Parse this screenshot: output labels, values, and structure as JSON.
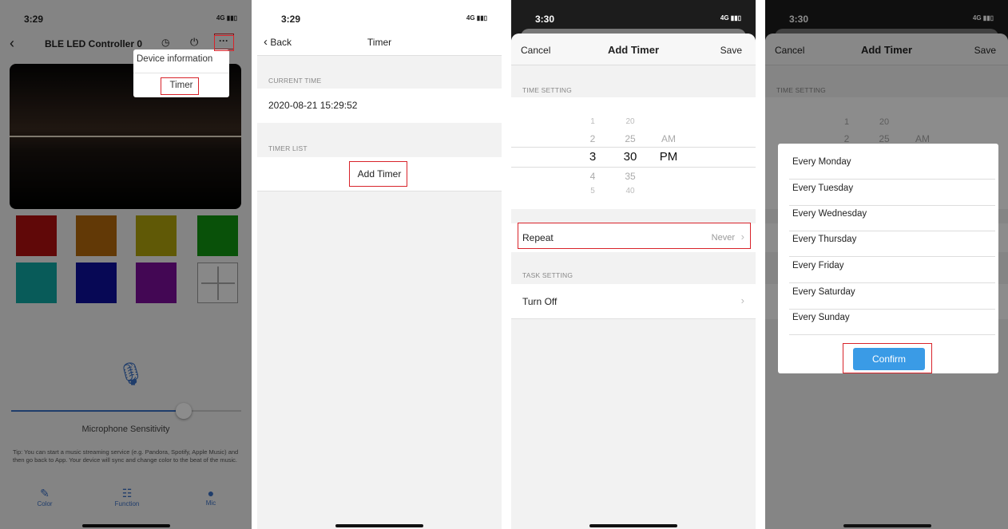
{
  "status_times": [
    "3:29",
    "3:29",
    "3:30",
    "3:30"
  ],
  "signal": "4G",
  "p1": {
    "device_title": "BLE LED Controller 0",
    "menu": {
      "device_information": "Device information",
      "timer": "Timer"
    },
    "mic_sensitivity_label": "Microphone Sensitivity",
    "tip": "Tip: You can start a music streaming service (e.g. Pandora, Spotify, Apple Music) and then go back to App. Your device will sync and change color to the beat of the music.",
    "tabs": {
      "color": "Color",
      "function": "Function",
      "mic": "Mic"
    },
    "swatches": [
      "#b01010",
      "#b2690c",
      "#b0a20c",
      "#119411",
      "#10a6a2",
      "#0e0f9c",
      "#7a0e99"
    ]
  },
  "p2": {
    "back": "Back",
    "title": "Timer",
    "current_time_header": "CURRENT TIME",
    "current_time": "2020-08-21 15:29:52",
    "timer_list_header": "TIMER LIST",
    "add_timer": "Add Timer"
  },
  "p3": {
    "cancel": "Cancel",
    "title": "Add Timer",
    "save": "Save",
    "time_setting_header": "TIME SETTING",
    "hours": [
      "1",
      "2",
      "3",
      "4",
      "5"
    ],
    "minutes": [
      "20",
      "25",
      "30",
      "35",
      "40"
    ],
    "ampm": [
      "AM",
      "PM"
    ],
    "repeat_label": "Repeat",
    "repeat_value": "Never",
    "task_setting_header": "TASK SETTING",
    "task_label": "Turn Off"
  },
  "p4": {
    "cancel": "Cancel",
    "title": "Add Timer",
    "save": "Save",
    "time_setting_header": "TIME SETTING",
    "bg_hours": [
      "1",
      "2"
    ],
    "bg_minutes": [
      "20",
      "25"
    ],
    "bg_ampm": "AM",
    "days": [
      "Every Monday",
      "Every Tuesday",
      "Every Wednesday",
      "Every Thursday",
      "Every Friday",
      "Every Saturday",
      "Every Sunday"
    ],
    "confirm": "Confirm"
  }
}
